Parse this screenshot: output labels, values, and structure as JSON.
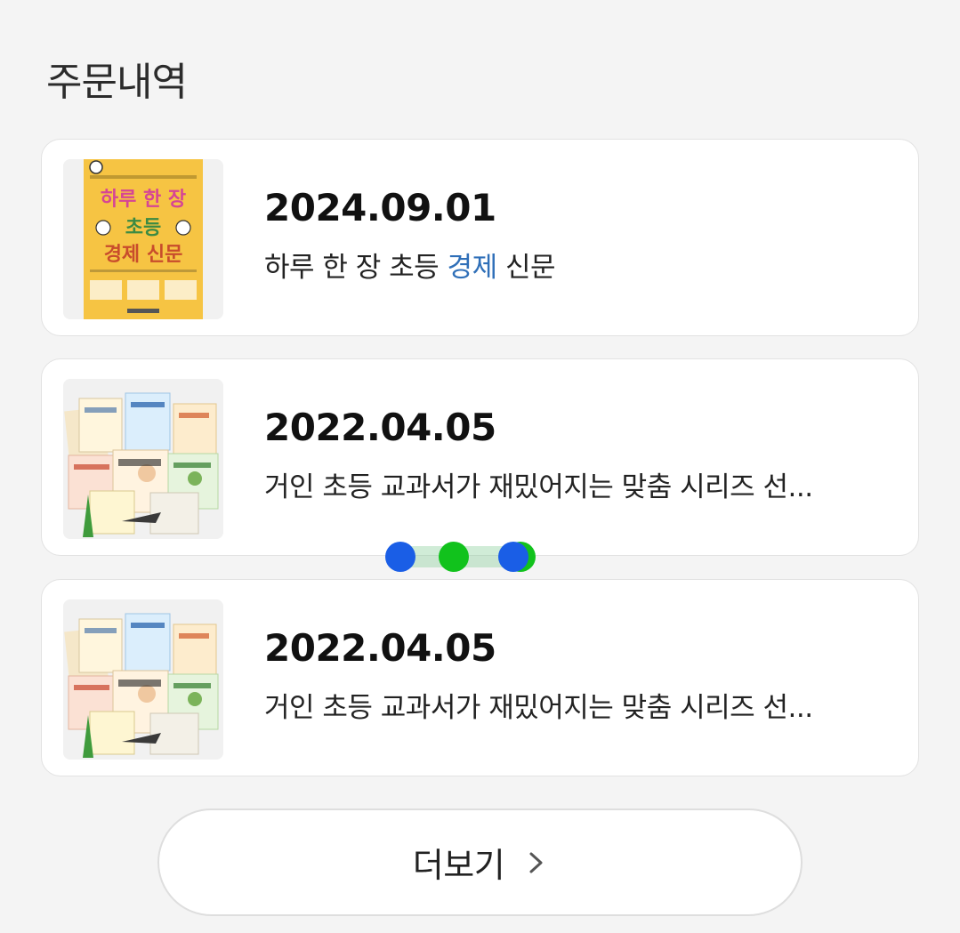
{
  "section": {
    "title": "주문내역"
  },
  "orders": [
    {
      "date": "2024.09.01",
      "title_parts": [
        "하루 한 장 초등 ",
        "경제",
        " 신문"
      ],
      "thumbnail": "book-cover-economy-newspaper-icon",
      "cover_text": {
        "line1": "하루 한 장",
        "line2": "초등",
        "line3": "경제 신문"
      },
      "highlight_color": "#2f6fb8"
    },
    {
      "date": "2022.04.05",
      "title": "거인 초등 교과서가 재밌어지는 맞춤 시리즈 선...",
      "thumbnail": "book-series-collage-icon"
    },
    {
      "date": "2022.04.05",
      "title": "거인 초등 교과서가 재밌어지는 맞춤 시리즈 선...",
      "thumbnail": "book-series-collage-icon"
    }
  ],
  "pager": {
    "dots": 3,
    "colors": [
      "#1a5ee6",
      "#11c21c"
    ]
  },
  "more_button": {
    "label": "더보기",
    "icon": "chevron-right-icon"
  }
}
